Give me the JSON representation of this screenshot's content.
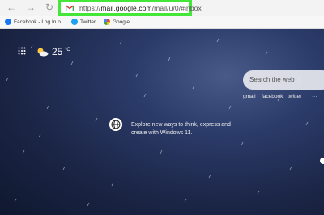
{
  "browser": {
    "address_url_prefix": "https://",
    "address_url_domain": "mail.google.com",
    "address_url_path": "/mail/u/0/#inbox"
  },
  "bookmarks": [
    {
      "label": "Facebook - Log In o...",
      "icon": "facebook-icon"
    },
    {
      "label": "Twitter",
      "icon": "twitter-icon"
    },
    {
      "label": "Google",
      "icon": "google-icon"
    }
  ],
  "newtab": {
    "temperature": "25",
    "temp_unit": "°C",
    "search_placeholder": "Search the web",
    "quick_links": [
      "gmail",
      "facebook",
      "twitter",
      "···"
    ],
    "tip_text": "Explore new ways to think, express and create with Windows 11."
  },
  "colors": {
    "highlight": "#45e63a"
  }
}
